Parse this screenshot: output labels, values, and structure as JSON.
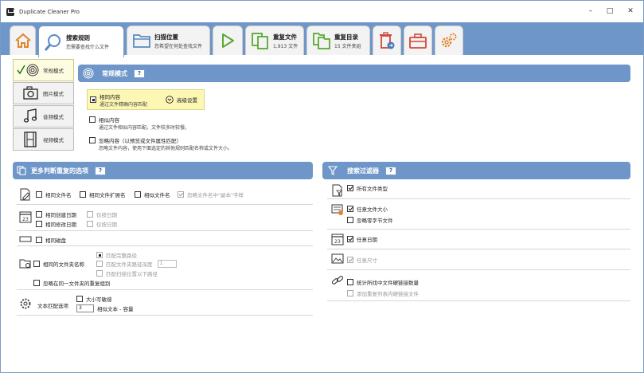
{
  "window": {
    "title": "Duplicate Cleaner Pro",
    "minimize": "–",
    "maximize": "□",
    "close": "✕"
  },
  "tabs": [
    {
      "title": "搜索规则",
      "subtitle": "您需要查找什么文件"
    },
    {
      "title": "扫描位置",
      "subtitle": "您希望在何处查找文件"
    },
    {
      "title": "重复文件",
      "subtitle": "1,913 文件"
    },
    {
      "title": "重复目录",
      "subtitle": "15 文件夹组"
    }
  ],
  "leftnav": [
    "常规模式",
    "图片模式",
    "音频模式",
    "视频模式"
  ],
  "mode_panel": {
    "title": "常规模式",
    "help": "?",
    "options": [
      {
        "title": "相同内容",
        "desc": "通过文件精确内容匹配"
      },
      {
        "title": "相似内容",
        "desc": "通过文件相似内容匹配。文件较多时较慢。"
      },
      {
        "title": "忽略内容（以预览或文件属性匹配）",
        "desc": "忽略文件内容，使用下面选定的其他规则匹配名称或文件大小。"
      }
    ],
    "advanced_label": "高级设置"
  },
  "more_panel": {
    "title": "更多判断重复的选项",
    "help": "?",
    "same_filename": "相同文件名",
    "same_ext": "相同文件扩展名",
    "similar_name": "相似文件名",
    "ignore_copy": "忽略文件名中\"副本\"字样",
    "same_created": "相同创建日期",
    "same_modified": "相同修改日期",
    "date_only_1": "仅按日期",
    "date_only_2": "仅按日期",
    "same_drive": "相同磁盘",
    "same_folder": "相同的文件夹名称",
    "match_full_path": "匹配完整路径",
    "match_depth": "匹配文件夹路径深度",
    "match_below": "匹配扫描位置以下路径",
    "depth_value": "1",
    "ignore_same_folder": "忽略在同一文件夹的重复组别",
    "text_match_label": "文本匹配选项",
    "case_sensitive": "大小写敏感",
    "similar_text_value": "3",
    "similar_text": "相似文本 - 容量"
  },
  "filter_panel": {
    "title": "搜索过滤器",
    "help": "?",
    "all_types": "所有文件类型",
    "any_size": "任意文件大小",
    "ignore_zero": "忽略零字节文件",
    "any_date": "任意日期",
    "any_dimensions": "任意尺寸",
    "count_hardlinks": "统计所找中文件硬链接数量",
    "add_hardlinks": "添加重复列表内硬链接文件"
  },
  "colors": {
    "accent": "#6e96c8",
    "highlight": "#fdf7b4",
    "orange": "#e0862a"
  }
}
